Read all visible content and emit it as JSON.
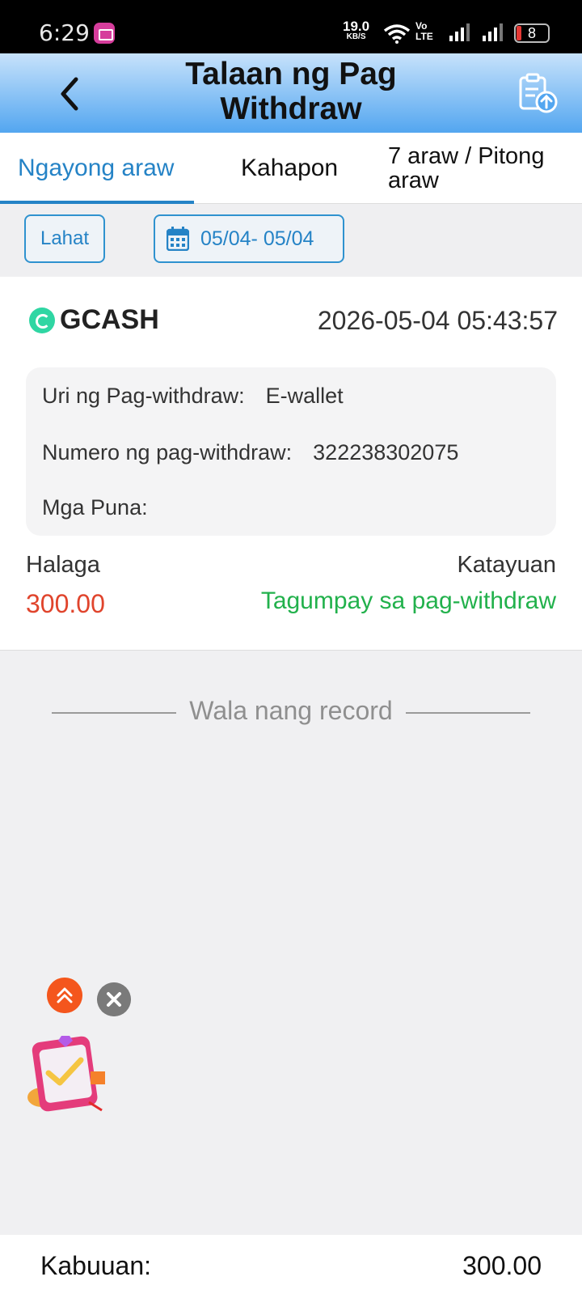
{
  "status_bar": {
    "time": "6:29",
    "net_speed": "19.0",
    "net_speed_unit": "KB/S",
    "volte_top": "Vo",
    "volte_bottom": "LTE",
    "battery": "8",
    "icons": [
      "app-notification-icon",
      "wifi-icon",
      "volte-icon",
      "signal-icon",
      "signal-icon",
      "battery-icon"
    ]
  },
  "header": {
    "title": "Talaan ng Pag Withdraw",
    "back_icon": "chevron-left-icon",
    "export_icon": "clipboard-upload-icon"
  },
  "tabs": [
    {
      "label": "Ngayong araw",
      "active": true
    },
    {
      "label": "Kahapon",
      "active": false
    },
    {
      "label": "7 araw / Pitong araw",
      "active": false
    }
  ],
  "filters": {
    "all_label": "Lahat",
    "date_range": "05/04- 05/04",
    "date_icon": "calendar-icon"
  },
  "record": {
    "method": "GCASH",
    "method_icon": "gcash-logo-icon",
    "datetime": "2026-05-04 05:43:57",
    "type_label": "Uri ng Pag-withdraw",
    "type_value": "E-wallet",
    "number_label": "Numero ng pag-withdraw",
    "number_value": "322238302075",
    "remarks_label": "Mga Puna",
    "remarks_value": "",
    "separator": ":",
    "amount_label": "Halaga",
    "amount_value": "300.00",
    "status_label": "Katayuan",
    "status_value": "Tagumpay sa pag-withdraw"
  },
  "no_more_text": "Wala nang record",
  "floating_promo": {
    "expand_icon": "double-chevron-up-icon",
    "close_icon": "close-icon",
    "graphic": "task-clipboard-gift-icon"
  },
  "footer": {
    "total_label": "Kabuuan:",
    "total_value": "300.00"
  },
  "colors": {
    "accent": "#2583c6",
    "amount": "#e0442c",
    "success": "#22b14c",
    "header_gradient_top": "#c7e2fb",
    "header_gradient_bottom": "#53a6f0"
  }
}
